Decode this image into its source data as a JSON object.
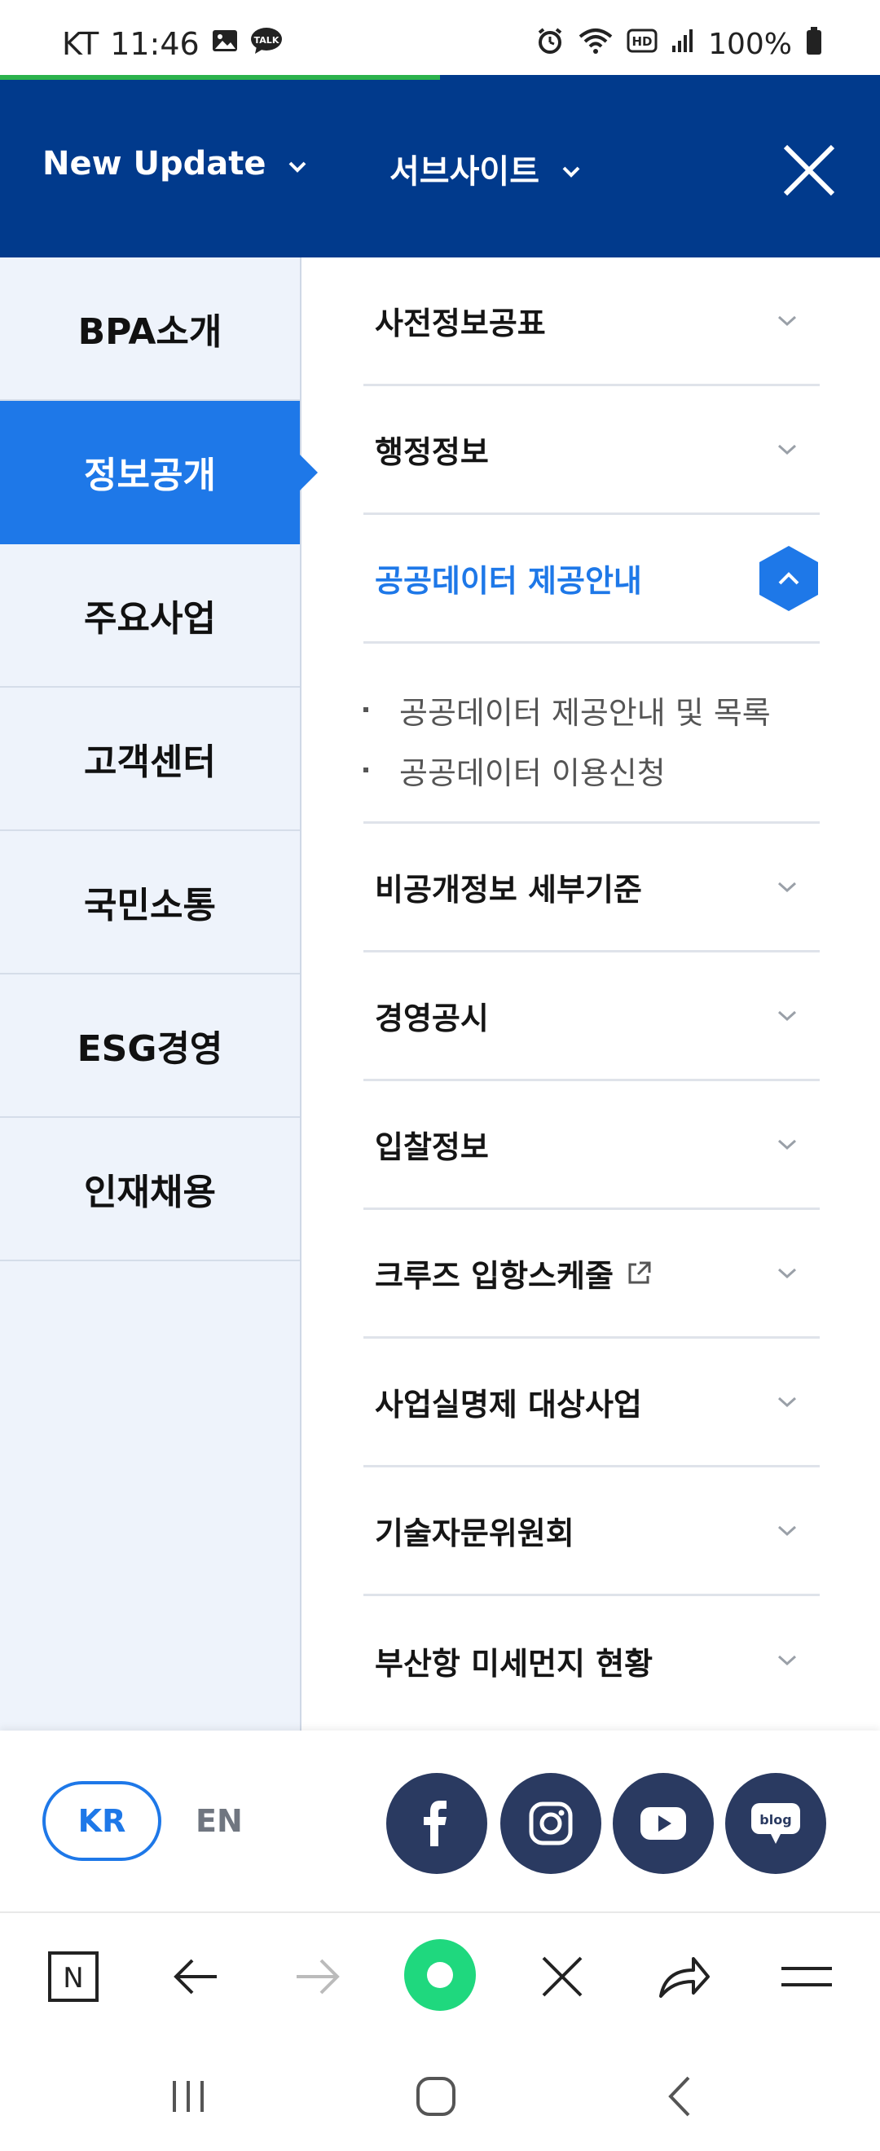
{
  "status_bar": {
    "carrier": "KT",
    "time": "11:46",
    "battery": "100%",
    "left_icons": [
      "image-icon",
      "talk-icon"
    ],
    "right_icons": [
      "alarm-icon",
      "wifi-icon",
      "hd-icon",
      "signal-icon",
      "battery-icon"
    ],
    "talk_label": "TALK",
    "hd_label": "HD"
  },
  "header": {
    "new_update_label": "New Update",
    "subsite_label": "서브사이트",
    "close_icon": "close-icon",
    "bg_color": "#013a8c"
  },
  "left_nav": {
    "items": [
      {
        "label": "BPA소개",
        "active": false
      },
      {
        "label": "정보공개",
        "active": true
      },
      {
        "label": "주요사업",
        "active": false
      },
      {
        "label": "고객센터",
        "active": false
      },
      {
        "label": "국민소통",
        "active": false
      },
      {
        "label": "ESG경영",
        "active": false
      },
      {
        "label": "인재채용",
        "active": false
      }
    ],
    "active_color": "#1e78e8"
  },
  "right_list": {
    "items": [
      {
        "label": "사전정보공표"
      },
      {
        "label": "행정정보"
      },
      {
        "label": "공공데이터 제공안내",
        "expanded": true,
        "children": [
          "공공데이터 제공안내 및 목록",
          "공공데이터 이용신청"
        ]
      },
      {
        "label": "비공개정보 세부기준"
      },
      {
        "label": "경영공시"
      },
      {
        "label": "입찰정보"
      },
      {
        "label": "크루즈 입항스케줄",
        "external": true
      },
      {
        "label": "사업실명제 대상사업"
      },
      {
        "label": "기술자문위원회"
      },
      {
        "label": "부산항 미세먼지 현황"
      }
    ]
  },
  "footer": {
    "lang_kr": "KR",
    "lang_en": "EN",
    "social": [
      "facebook-icon",
      "instagram-icon",
      "youtube-icon",
      "blog-icon"
    ],
    "blog_label": "blog"
  },
  "browser_toolbar": {
    "buttons": [
      "naver-home-icon",
      "back-arrow-icon",
      "forward-arrow-icon",
      "green-dot-icon",
      "close-tab-icon",
      "share-icon",
      "menu-icon"
    ],
    "naver_label": "N"
  },
  "system_nav": {
    "buttons": [
      "recents-icon",
      "home-icon",
      "back-icon"
    ]
  }
}
